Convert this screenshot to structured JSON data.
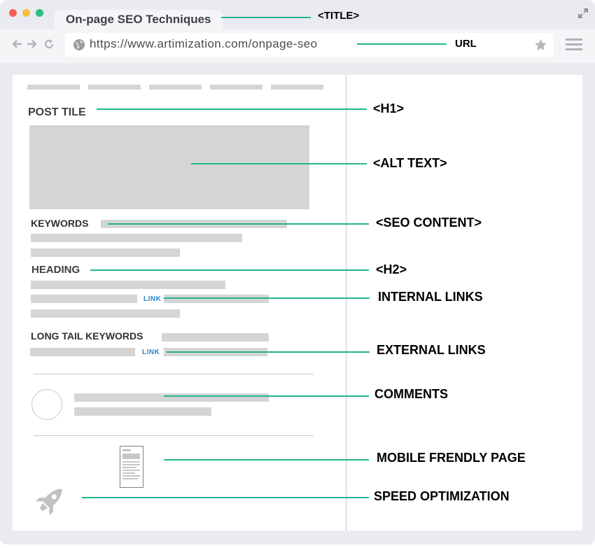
{
  "browser": {
    "tab_title": "On-page SEO Techniques",
    "url": "https://www.artimization.com/onpage-seo",
    "colors": {
      "close": "#f26158",
      "minimize": "#f6bf40",
      "maximize": "#2fbc87",
      "connector": "#25b491",
      "link": "#2a86c8"
    }
  },
  "page": {
    "post_title": "POST TILE",
    "keywords": "KEYWORDS",
    "heading": "HEADING",
    "link1": "LINK",
    "long_tail": "LONG TAIL KEYWORDS",
    "link2": "LINK"
  },
  "annotations": {
    "title": "<TITLE>",
    "url": "URL",
    "h1": "<H1>",
    "alt_text": "<ALT TEXT>",
    "seo_content": "<SEO CONTENT>",
    "h2": "<H2>",
    "internal_links": "INTERNAL LINKS",
    "external_links": "EXTERNAL LINKS",
    "comments": "COMMENTS",
    "mobile": "MOBILE FRENDLY PAGE",
    "speed": "SPEED OPTIMIZATION"
  }
}
